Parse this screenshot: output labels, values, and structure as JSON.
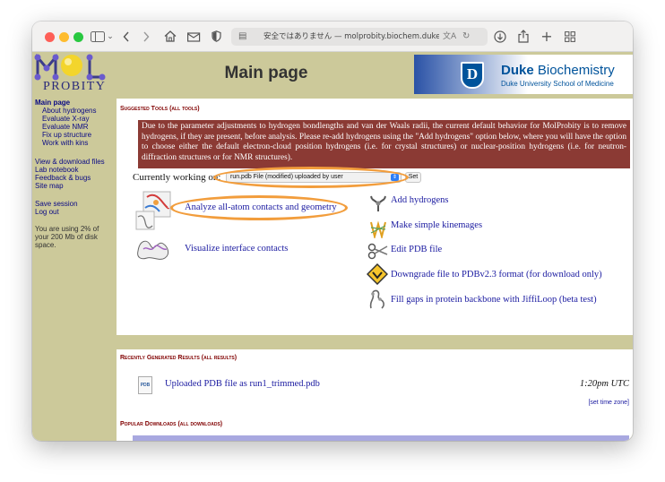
{
  "browser": {
    "address_bar": "安全ではありません — molprobity.biochem.duke.edu/i",
    "icons": [
      "sidebar-icon",
      "chevron-down-icon",
      "back-icon",
      "forward-icon",
      "home-icon",
      "mail-icon",
      "shield-icon",
      "page-icon",
      "translate-icon",
      "reload-icon",
      "download-icon",
      "share-icon",
      "new-tab-icon",
      "tab-overview-icon"
    ]
  },
  "header": {
    "logo_text": "PROBITY",
    "title": "Main page",
    "duke_name_bold": "Duke",
    "duke_name_rest": " Biochemistry",
    "duke_subtitle": "Duke University School of Medicine",
    "duke_shield_letter": "D"
  },
  "sidebar": {
    "items": [
      {
        "label": "Main page"
      },
      {
        "label": "About hydrogens"
      },
      {
        "label": "Evaluate X-ray"
      },
      {
        "label": "Evaluate NMR"
      },
      {
        "label": "Fix up structure"
      },
      {
        "label": "Work with kins"
      },
      {
        "label": "View & download files"
      },
      {
        "label": "Lab notebook"
      },
      {
        "label": "Feedback & bugs"
      },
      {
        "label": "Site map"
      },
      {
        "label": "Save session"
      },
      {
        "label": "Log out"
      }
    ],
    "disk_note": "You are using 2% of your 200 Mb of disk space."
  },
  "suggested": {
    "heading": "Suggested Tools",
    "all_link": "(all tools)",
    "warning": "Due to the parameter adjustments to hydrogen bondlengths and van der Waals radii, the current default behavior for MolProbity is to remove hydrogens, if they are present, before analysis. Please re-add hydrogens using the \"Add hydrogens\" option below, where you will have the option to choose either the default electron-cloud position hydrogens (i.e. for crystal structures) or nuclear-position hydrogens (i.e. for neutron-diffraction structures or for NMR structures).",
    "working_on": "Currently working on:",
    "file_select": "run.pdb      File (modified) uploaded by user",
    "set_button": "Set",
    "tools_left": [
      "Analyze all-atom contacts and geometry",
      "Visualize interface contacts"
    ],
    "tools_right": [
      "Add hydrogens",
      "Make simple kinemages",
      "Edit PDB file",
      "Downgrade file to PDBv2.3 format (for download only)",
      "Fill gaps in protein backbone with JiffiLoop (beta test)"
    ]
  },
  "recent": {
    "heading": "Recently Generated Results",
    "all_link": "(all results)",
    "file_badge": "PDB",
    "item_label": "Uploaded PDB file as run1_trimmed.pdb",
    "item_time": "1:20pm UTC",
    "timezone_link": "[set time zone]"
  },
  "popular": {
    "heading": "Popular Downloads",
    "all_link": "(all downloads)"
  },
  "colors": {
    "page_bg": "#ccc99a",
    "warning_bg": "#8b3a34",
    "link": "#1a1aa0",
    "section_heading": "#800000",
    "highlight_oval": "#f29d3c",
    "duke_blue": "#00539b"
  }
}
